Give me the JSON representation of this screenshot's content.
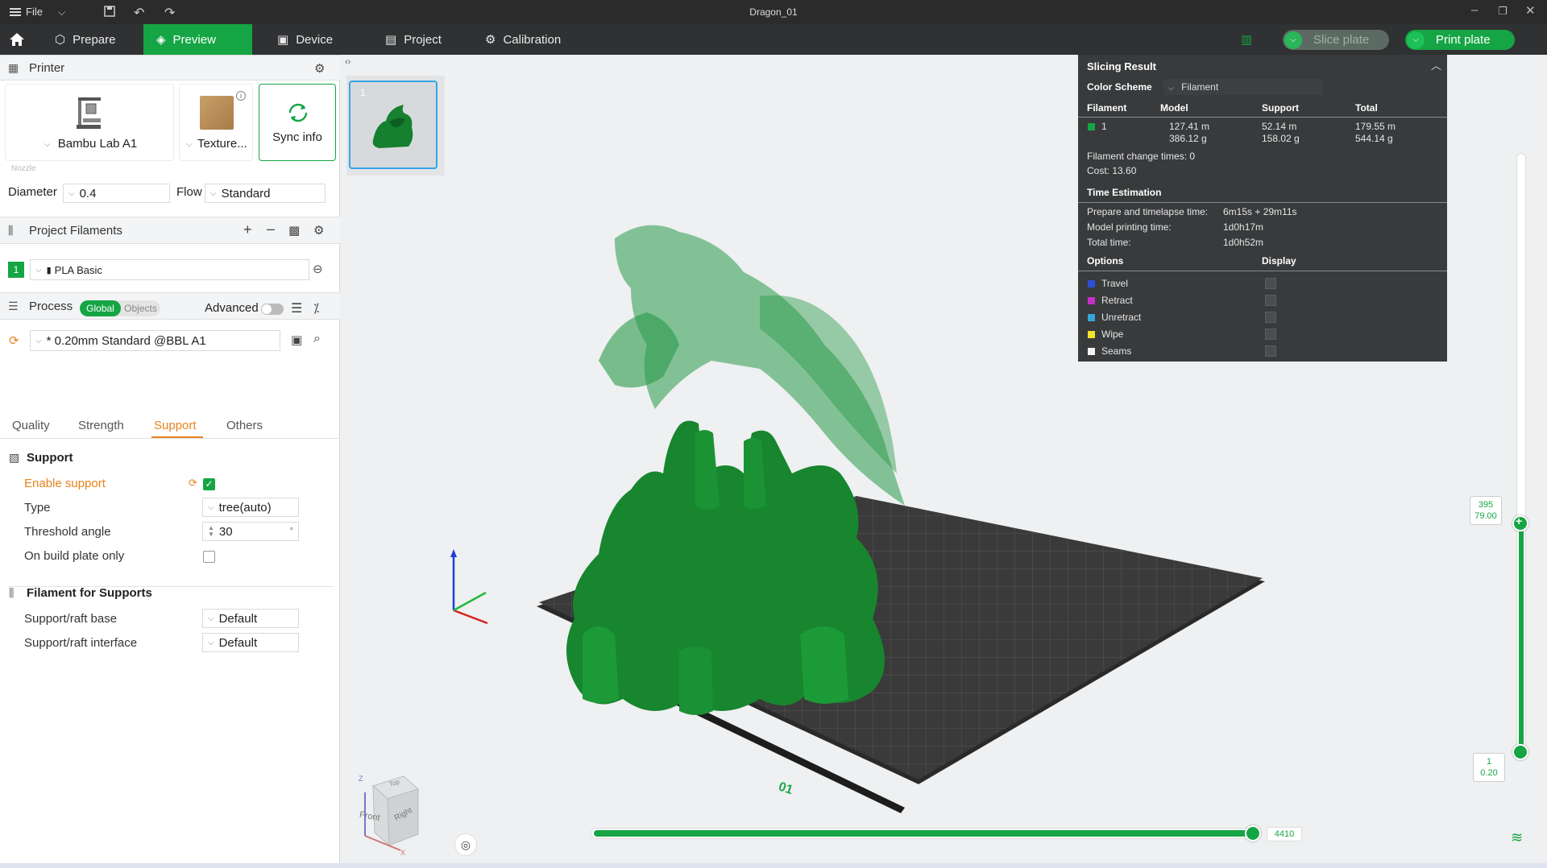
{
  "titlebar": {
    "file_label": "File",
    "title": "Dragon_01"
  },
  "nav": {
    "tabs": [
      "Prepare",
      "Preview",
      "Device",
      "Project",
      "Calibration"
    ],
    "active": "Preview",
    "slice_label": "Slice plate",
    "print_label": "Print plate"
  },
  "printer": {
    "section_title": "Printer",
    "printer_name": "Bambu Lab A1",
    "plate_name": "Texture...",
    "sync_label": "Sync info",
    "nozzle_caption": "Nozzle",
    "diameter_label": "Diameter",
    "diameter_value": "0.4",
    "flow_label": "Flow",
    "flow_value": "Standard"
  },
  "filaments": {
    "section_title": "Project Filaments",
    "items": [
      {
        "index": "1",
        "name": "PLA Basic",
        "color": "#15a544"
      }
    ]
  },
  "process": {
    "section_title": "Process",
    "toggle_global": "Global",
    "toggle_objects": "Objects",
    "advanced_label": "Advanced",
    "preset": "* 0.20mm Standard @BBL A1",
    "tabs": [
      "Quality",
      "Strength",
      "Support",
      "Others"
    ],
    "active_tab": "Support",
    "support_group": "Support",
    "enable_support_label": "Enable support",
    "enable_support": true,
    "type_label": "Type",
    "type_value": "tree(auto)",
    "threshold_label": "Threshold angle",
    "threshold_value": "30",
    "threshold_unit": "°",
    "build_plate_only_label": "On build plate only",
    "build_plate_only": false,
    "filament_support_group": "Filament for Supports",
    "raft_base_label": "Support/raft base",
    "raft_base_value": "Default",
    "raft_interface_label": "Support/raft interface",
    "raft_interface_value": "Default"
  },
  "plate": {
    "thumb_number": "1",
    "plate_label": "01"
  },
  "results": {
    "title": "Slicing Result",
    "color_scheme_label": "Color Scheme",
    "color_scheme_value": "Filament",
    "headers": [
      "Filament",
      "Model",
      "Support",
      "Total"
    ],
    "row": {
      "filament": "1",
      "model_len": "127.41 m",
      "model_wt": "386.12 g",
      "support_len": "52.14 m",
      "support_wt": "158.02 g",
      "total_len": "179.55 m",
      "total_wt": "544.14 g",
      "color": "#15a544"
    },
    "change_times": "Filament change times:  0",
    "cost": "Cost:  13.60",
    "time_title": "Time Estimation",
    "prepare_label": "Prepare and timelapse time:",
    "prepare_value": "6m15s + 29m11s",
    "model_time_label": "Model printing time:",
    "model_time_value": "1d0h17m",
    "total_time_label": "Total time:",
    "total_time_value": "1d0h52m",
    "options_label": "Options",
    "display_label": "Display",
    "options": [
      {
        "name": "Travel",
        "color": "#2f4fd6"
      },
      {
        "name": "Retract",
        "color": "#c531c8"
      },
      {
        "name": "Unretract",
        "color": "#34a7d8"
      },
      {
        "name": "Wipe",
        "color": "#f2e32b"
      },
      {
        "name": "Seams",
        "color": "#f2f2f2"
      }
    ]
  },
  "layer_slider": {
    "top_layer": "395",
    "top_height": "79.00",
    "bottom_layer": "1",
    "bottom_height": "0.20"
  },
  "move_slider": {
    "value": "4410"
  },
  "view_cube": {
    "front": "Front",
    "right": "Right",
    "top": "Top",
    "axis_x": "X",
    "axis_z": "Z"
  }
}
